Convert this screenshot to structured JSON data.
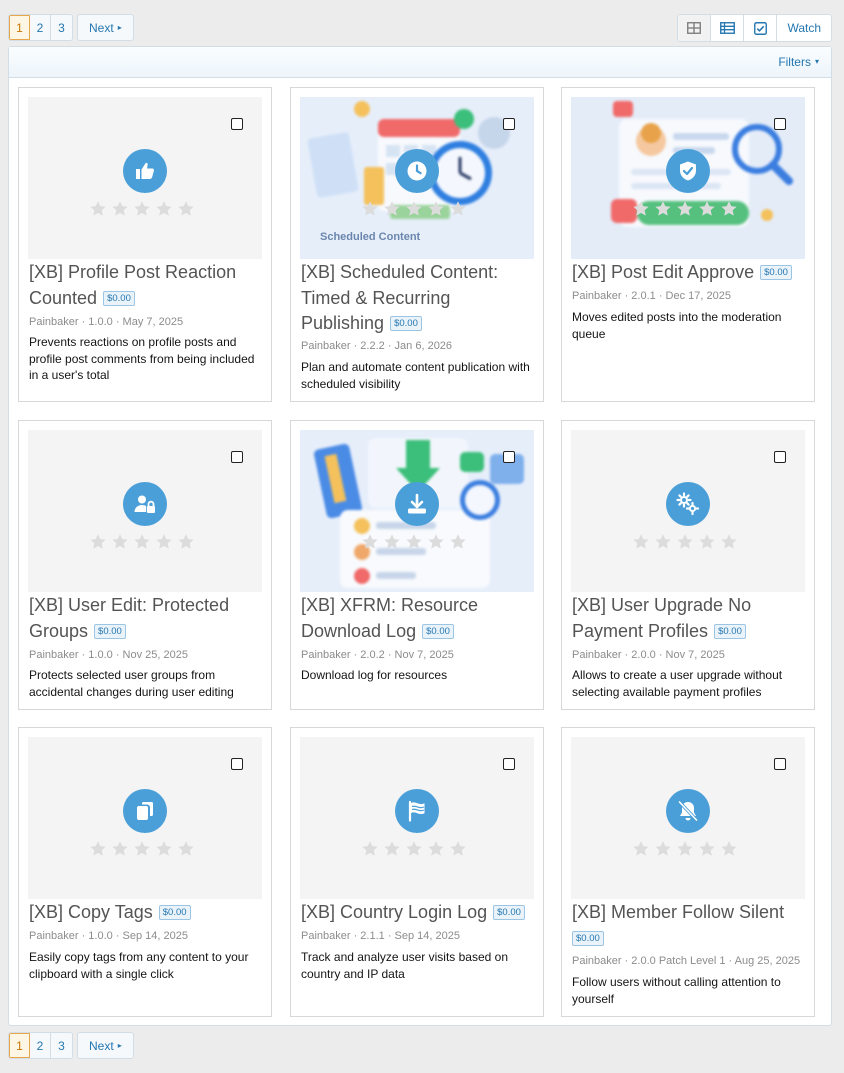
{
  "pagination": {
    "pages": [
      "1",
      "2",
      "3"
    ],
    "current": "1",
    "next_label": "Next"
  },
  "view_controls": {
    "watch_label": "Watch"
  },
  "filters_label": "Filters",
  "colors": {
    "accent": "#2577b1",
    "icon_circle": "#4b9fd8",
    "star": "#dcdcdc"
  },
  "cards": [
    {
      "title": "[XB] Profile Post Reaction Counted",
      "price": "$0.00",
      "meta": "Painbaker · 1.0.0 · May 7, 2025",
      "description": "Prevents reactions on profile posts and profile post comments from being included in a user's total",
      "icon": "thumbs-up-icon"
    },
    {
      "title": "[XB] Scheduled Content: Timed & Recurring Publishing",
      "price": "$0.00",
      "meta": "Painbaker · 2.2.2 · Jan 6, 2026",
      "description": "Plan and automate content publication with scheduled visibility",
      "icon": "clock-icon",
      "thumb_text": "Scheduled Content"
    },
    {
      "title": "[XB] Post Edit Approve",
      "price": "$0.00",
      "meta": "Painbaker · 2.0.1 · Dec 17, 2025",
      "description": "Moves edited posts into the moderation queue",
      "icon": "shield-check-icon"
    },
    {
      "title": "[XB] User Edit: Protected Groups",
      "price": "$0.00",
      "meta": "Painbaker · 1.0.0 · Nov 25, 2025",
      "description": "Protects selected user groups from accidental changes during user editing",
      "icon": "user-lock-icon"
    },
    {
      "title": "[XB] XFRM: Resource Download Log",
      "price": "$0.00",
      "meta": "Painbaker · 2.0.2 · Nov 7, 2025",
      "description": "Download log for resources",
      "icon": "download-icon"
    },
    {
      "title": "[XB] User Upgrade No Payment Profiles",
      "price": "$0.00",
      "meta": "Painbaker · 2.0.0 · Nov 7, 2025",
      "description": "Allows to create a user upgrade without selecting available payment profiles",
      "icon": "gears-icon"
    },
    {
      "title": "[XB] Copy Tags",
      "price": "$0.00",
      "meta": "Painbaker · 1.0.0 · Sep 14, 2025",
      "description": "Easily copy tags from any content to your clipboard with a single click",
      "icon": "copy-icon"
    },
    {
      "title": "[XB] Country Login Log",
      "price": "$0.00",
      "meta": "Painbaker · 2.1.1 · Sep 14, 2025",
      "description": "Track and analyze user visits based on country and IP data",
      "icon": "flag-icon"
    },
    {
      "title": "[XB] Member Follow Silent",
      "price": "$0.00",
      "meta": "Painbaker · 2.0.0 Patch Level 1 · Aug 25, 2025",
      "description": "Follow users without calling attention to yourself",
      "icon": "bell-slash-icon"
    }
  ]
}
